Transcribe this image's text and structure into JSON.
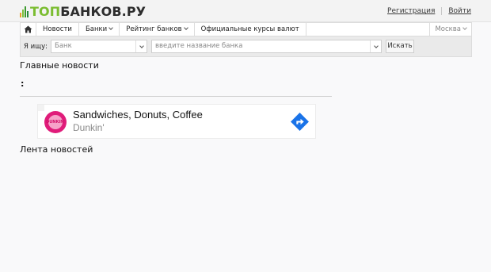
{
  "header": {
    "logo_part1": "ТОП",
    "logo_part2": "БАНКОВ.РУ",
    "register": "Регистрация",
    "login": "Войти"
  },
  "nav": {
    "home_icon": "home-icon",
    "items": [
      "Новости",
      "Банки",
      "Рейтинг банков",
      "Официальные курсы валют"
    ],
    "city": "Москва"
  },
  "search": {
    "label": "Я ищу:",
    "type_value": "Банк",
    "query_placeholder": "введите название банка",
    "button": "Искать"
  },
  "main": {
    "title": "Главные новости",
    "colon": ":",
    "feed_title": "Лента новостей"
  },
  "ad": {
    "logo_text": "DUNKIN'",
    "title": "Sandwiches, Donuts, Coffee",
    "advertiser": "Dunkin'",
    "colors": {
      "brand": "#e01c7a",
      "cta": "#1a73e8"
    }
  },
  "colors": {
    "logo_accent": "#7bbd31",
    "logo_dark": "#2d2d2d"
  }
}
